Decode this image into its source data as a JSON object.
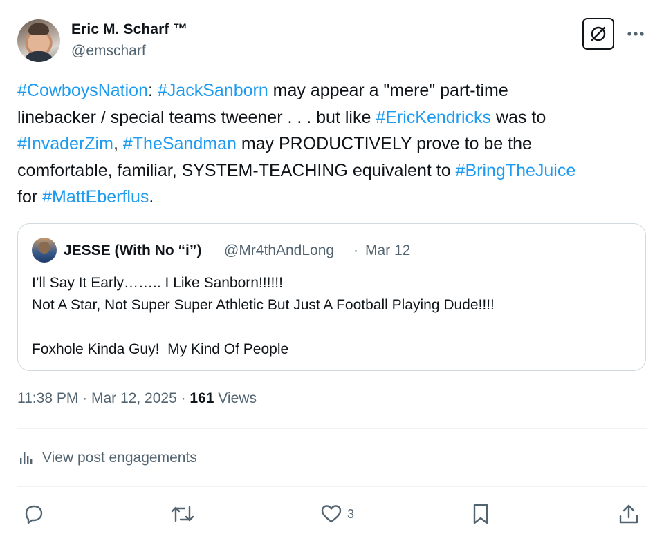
{
  "author": {
    "name": "Eric M. Scharf ™",
    "handle": "@emscharf"
  },
  "post": {
    "lines": [
      [
        {
          "t": "#CowboysNation",
          "tag": true
        },
        {
          "t": ": "
        },
        {
          "t": "#JackSanborn",
          "tag": true
        },
        {
          "t": " may appear a \"mere\" part-time"
        }
      ],
      [
        {
          "t": "linebacker / special teams tweener . . . but like "
        },
        {
          "t": "#EricKendricks",
          "tag": true
        },
        {
          "t": " was to"
        }
      ],
      [
        {
          "t": "#InvaderZim",
          "tag": true
        },
        {
          "t": ", "
        },
        {
          "t": "#TheSandman",
          "tag": true
        },
        {
          "t": " may PRODUCTIVELY prove to be the"
        }
      ],
      [
        {
          "t": "comfortable, familiar, SYSTEM-TEACHING equivalent to "
        },
        {
          "t": "#BringTheJuice",
          "tag": true
        }
      ],
      [
        {
          "t": "for "
        },
        {
          "t": "#MattEberflus",
          "tag": true
        },
        {
          "t": "."
        }
      ]
    ]
  },
  "quote": {
    "name": "JESSE (With No “i”)",
    "handle": "@Mr4thAndLong",
    "separator": "·",
    "date": "Mar 12",
    "lines": [
      "I’ll Say It Early…….. I Like Sanborn!!!!!!",
      "Not A Star, Not Super Super Athletic But Just A Football Playing Dude!!!!",
      "",
      "Foxhole Kinda Guy!  My Kind Of People"
    ]
  },
  "meta": {
    "time": "11:38 PM",
    "sep1": " · ",
    "date": "Mar 12, 2025",
    "sep2": " · ",
    "views": "161",
    "views_label": " Views"
  },
  "engagements_label": "View post engagements",
  "actions": {
    "reply": "",
    "repost": "",
    "like": "3",
    "bookmark": "",
    "share": ""
  },
  "colors": {
    "hashtag": "#1d9bf0",
    "secondary_text": "#536471",
    "primary_text": "#0f1419",
    "border": "#cfd9de"
  }
}
